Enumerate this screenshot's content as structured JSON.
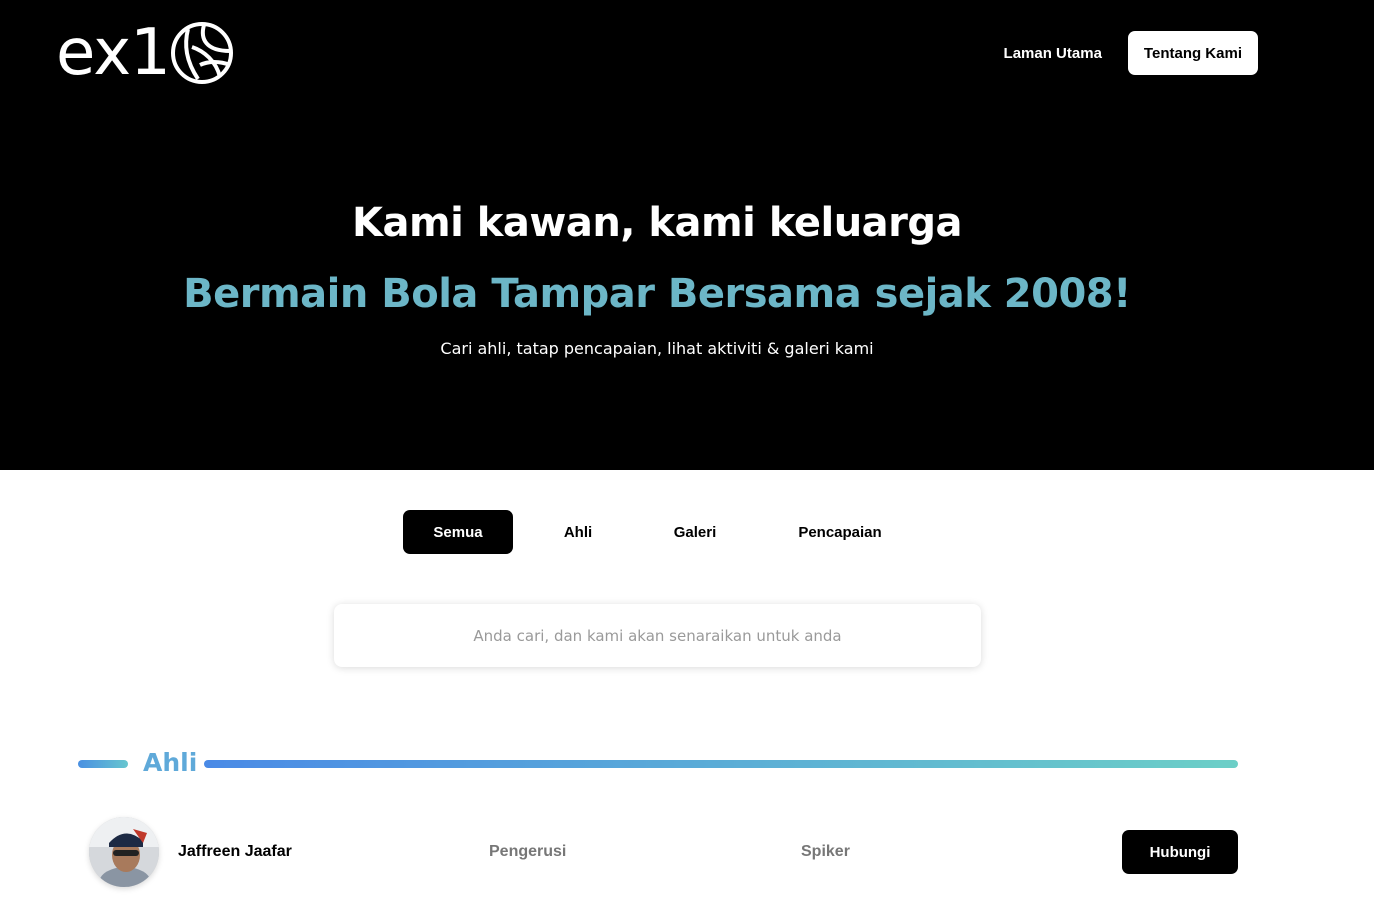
{
  "brand": {
    "logo_text": "ex1",
    "logo_icon": "volleyball-icon"
  },
  "nav": {
    "home_label": "Laman Utama",
    "about_label": "Tentang Kami"
  },
  "hero": {
    "title": "Kami kawan, kami keluarga",
    "subtitle": "Bermain Bola Tampar Bersama sejak 2008!",
    "description": "Cari ahli, tatap pencapaian, lihat aktiviti & galeri kami"
  },
  "tabs": [
    {
      "label": "Semua",
      "active": true
    },
    {
      "label": "Ahli",
      "active": false
    },
    {
      "label": "Galeri",
      "active": false
    },
    {
      "label": "Pencapaian",
      "active": false
    }
  ],
  "search": {
    "placeholder": "Anda cari, dan kami akan senaraikan untuk anda",
    "value": ""
  },
  "section": {
    "title": "Ahli"
  },
  "members": [
    {
      "name": "Jaffreen Jaafar",
      "role": "Pengerusi",
      "position": "Spiker",
      "action_label": "Hubungi"
    }
  ],
  "colors": {
    "accent": "#6cb6c7",
    "section_title": "#5fa9d9",
    "gradient_start": "#4a8ae6",
    "gradient_end": "#6ccfc7",
    "background_dark": "#000000"
  }
}
